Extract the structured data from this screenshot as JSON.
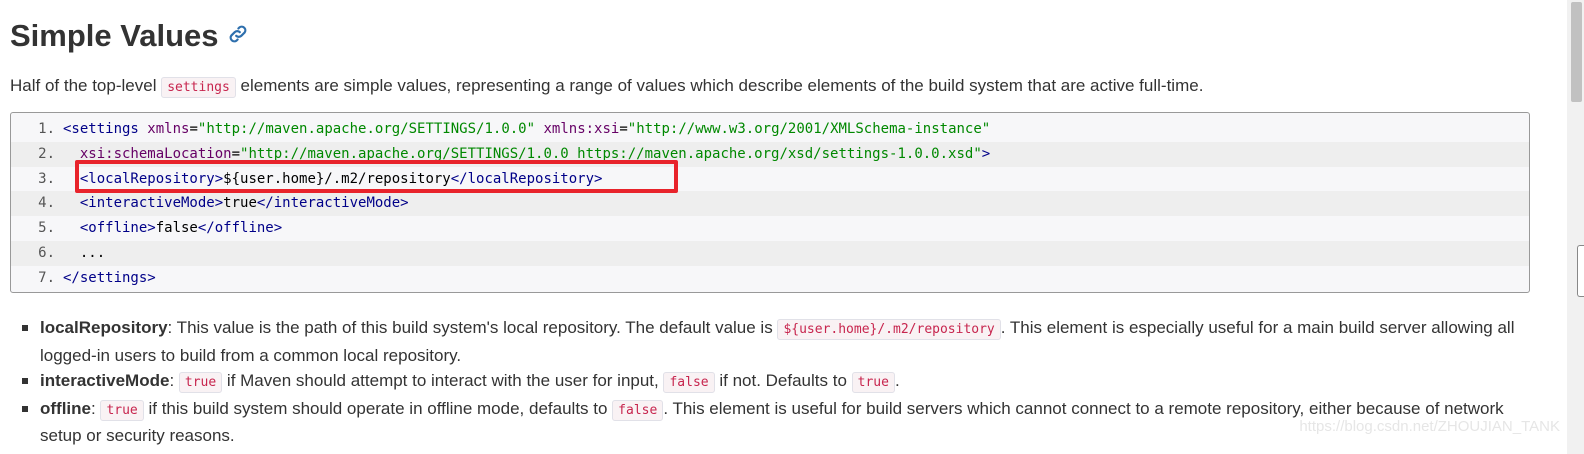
{
  "heading": "Simple Values",
  "intro": {
    "before": "Half of the top-level ",
    "code": "settings",
    "after": " elements are simple values, representing a range of values which describe elements of the build system that are active full-time."
  },
  "code_lines": [
    {
      "num": "1.",
      "parts": [
        [
          "tag",
          "<settings "
        ],
        [
          "attr",
          "xmlns"
        ],
        [
          "txt",
          "="
        ],
        [
          "str",
          "\"http://maven.apache.org/SETTINGS/1.0.0\""
        ],
        [
          "txt",
          " "
        ],
        [
          "attr",
          "xmlns:xsi"
        ],
        [
          "txt",
          "="
        ],
        [
          "str",
          "\"http://www.w3.org/2001/XMLSchema-instance\""
        ]
      ]
    },
    {
      "num": "2.",
      "parts": [
        [
          "txt",
          "  "
        ],
        [
          "attr",
          "xsi:schemaLocation"
        ],
        [
          "txt",
          "="
        ],
        [
          "str",
          "\"http://maven.apache.org/SETTINGS/1.0.0 https://maven.apache.org/xsd/settings-1.0.0.xsd\""
        ],
        [
          "tag",
          ">"
        ]
      ]
    },
    {
      "num": "3.",
      "parts": [
        [
          "txt",
          "  "
        ],
        [
          "tag",
          "<localRepository>"
        ],
        [
          "txt",
          "${user.home}/.m2/repository"
        ],
        [
          "tag",
          "</localRepository>"
        ]
      ]
    },
    {
      "num": "4.",
      "parts": [
        [
          "txt",
          "  "
        ],
        [
          "tag",
          "<interactiveMode>"
        ],
        [
          "txt",
          "true"
        ],
        [
          "tag",
          "</interactiveMode>"
        ]
      ]
    },
    {
      "num": "5.",
      "parts": [
        [
          "txt",
          "  "
        ],
        [
          "tag",
          "<offline>"
        ],
        [
          "txt",
          "false"
        ],
        [
          "tag",
          "</offline>"
        ]
      ]
    },
    {
      "num": "6.",
      "parts": [
        [
          "txt",
          "  ..."
        ]
      ]
    },
    {
      "num": "7.",
      "parts": [
        [
          "tag",
          "</settings>"
        ]
      ]
    }
  ],
  "definitions": [
    {
      "term": "localRepository",
      "segments": [
        [
          "text",
          ": This value is the path of this build system's local repository. The default value is "
        ],
        [
          "code",
          "${user.home}/.m2/repository"
        ],
        [
          "text",
          ". This element is especially useful for a main build server allowing all logged-in users to build from a common local repository."
        ]
      ]
    },
    {
      "term": "interactiveMode",
      "segments": [
        [
          "text",
          ": "
        ],
        [
          "code",
          "true"
        ],
        [
          "text",
          " if Maven should attempt to interact with the user for input, "
        ],
        [
          "code",
          "false"
        ],
        [
          "text",
          " if not. Defaults to "
        ],
        [
          "code",
          "true"
        ],
        [
          "text",
          "."
        ]
      ]
    },
    {
      "term": "offline",
      "segments": [
        [
          "text",
          ": "
        ],
        [
          "code",
          "true"
        ],
        [
          "text",
          " if this build system should operate in offline mode, defaults to "
        ],
        [
          "code",
          "false"
        ],
        [
          "text",
          ". This element is useful for build servers which cannot connect to a remote repository, either because of network setup or security reasons."
        ]
      ]
    }
  ],
  "watermark": "https://blog.csdn.net/ZHOUJIAN_TANK",
  "icons": {
    "anchor": "link-icon"
  },
  "colors": {
    "highlight": "#e8232b",
    "inline_code": "#c7254e"
  }
}
